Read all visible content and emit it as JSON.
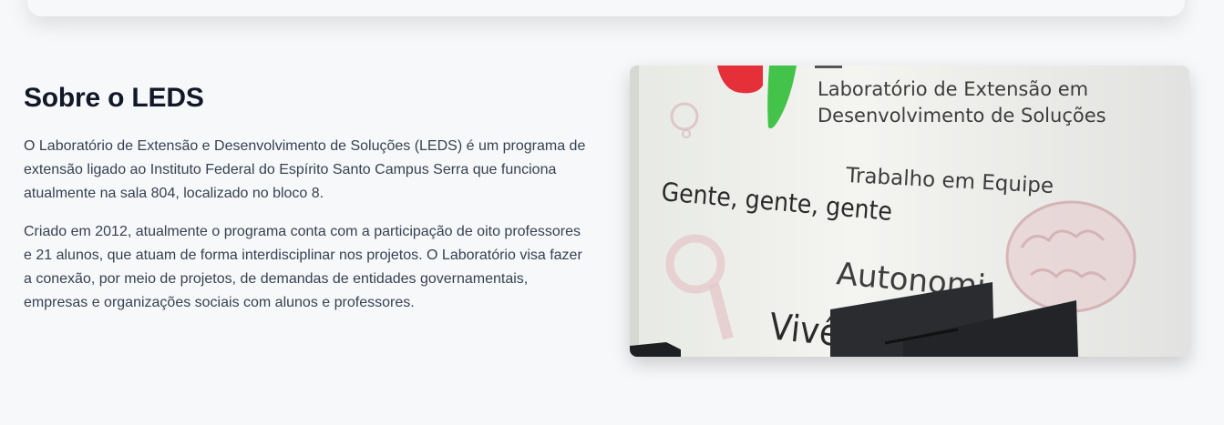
{
  "section": {
    "title": "Sobre o LEDS",
    "paragraphs": [
      "O Laboratório de Extensão e Desenvolvimento de Soluções (LEDS) é um programa de extensão ligado ao Instituto Federal do Espírito Santo Campus Serra que funciona atualmente na sala 804, localizado no bloco 8.",
      "Criado em 2012, atualmente o programa conta com a participação de oito professores e 21 alunos, que atuam de forma interdisciplinar nos projetos. O Laboratório visa fazer a conexão, por meio de projetos, de demandas de entidades governamentais, empresas e organizações sociais com alunos e professores."
    ]
  },
  "photo": {
    "wall_title_line1": "Laboratório de Extensão em",
    "wall_title_line2": "Desenvolvimento de Soluções",
    "phrase_team": "Trabalho em Equipe",
    "phrase_people": "Gente, gente, gente",
    "phrase_autonomy": "Autonomi",
    "phrase_experience": "Vivên"
  }
}
